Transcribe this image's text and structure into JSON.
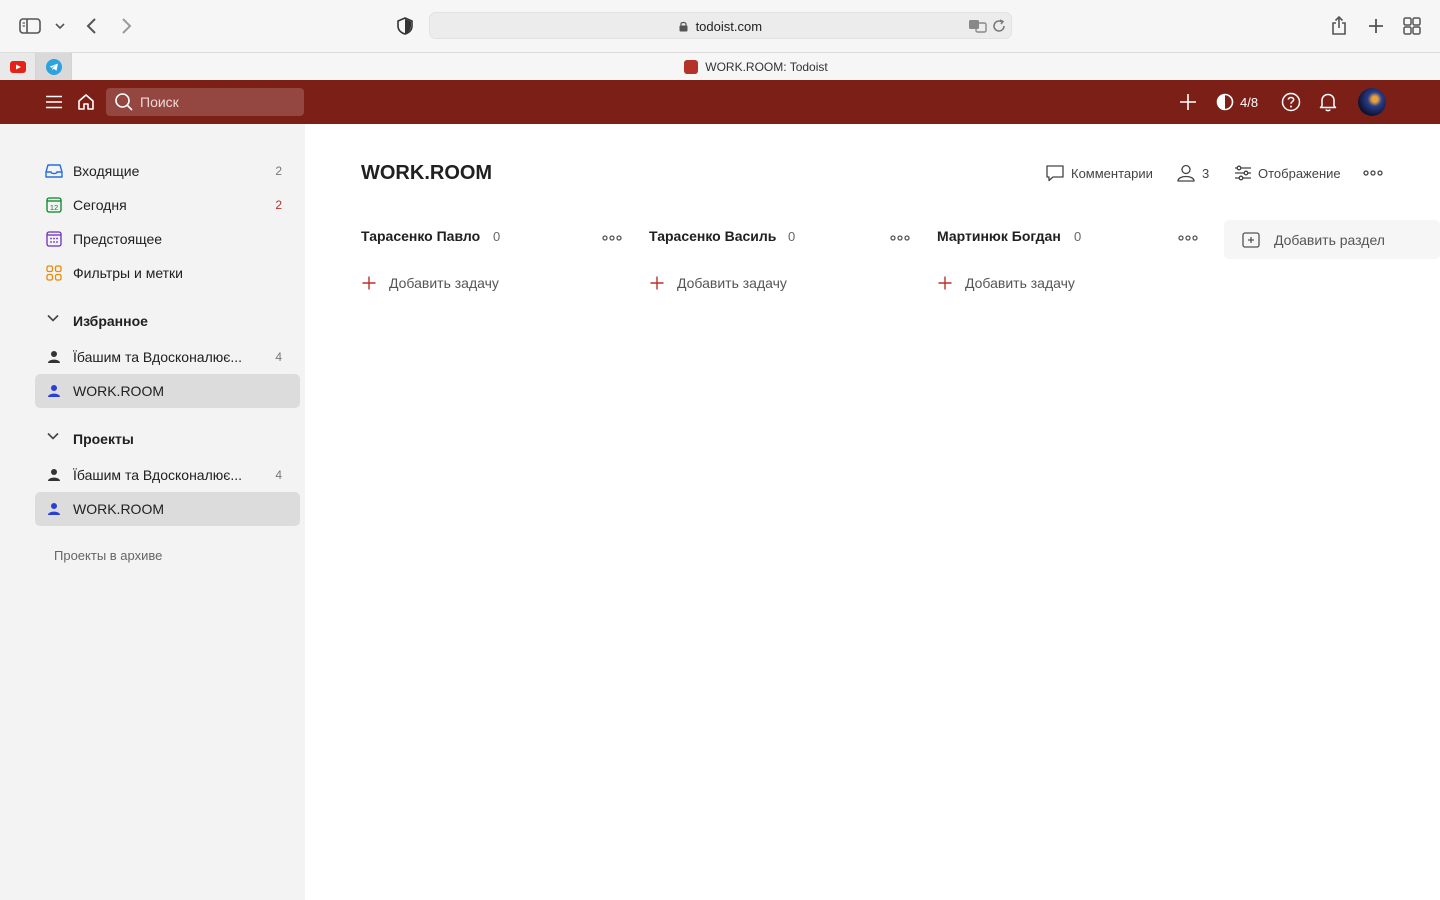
{
  "browser": {
    "url": "todoist.com",
    "active_tab_title": "WORK.ROOM: Todoist",
    "pinned_tabs": [
      {
        "name": "youtube",
        "color": "#e62117"
      },
      {
        "name": "telegram",
        "color": "#2aa3de"
      }
    ]
  },
  "topbar": {
    "search_placeholder": "Поиск",
    "karma": "4/8",
    "brand_color": "#7c1f17"
  },
  "sidebar": {
    "nav": [
      {
        "label": "Входящие",
        "count": "2",
        "icon": "inbox-icon"
      },
      {
        "label": "Сегодня",
        "count": "2",
        "icon": "today-calendar-icon"
      },
      {
        "label": "Предстоящее",
        "count": "",
        "icon": "upcoming-calendar-icon"
      },
      {
        "label": "Фильтры и метки",
        "count": "",
        "icon": "filters-grid-icon"
      }
    ],
    "favorites": {
      "title": "Избранное",
      "items": [
        {
          "label": "Їбашим та Вдосконалює...",
          "count": "4",
          "active": false
        },
        {
          "label": "WORK.ROOM",
          "count": "",
          "active": true
        }
      ]
    },
    "projects": {
      "title": "Проекты",
      "items": [
        {
          "label": "Їбашим та Вдосконалює...",
          "count": "4",
          "active": false
        },
        {
          "label": "WORK.ROOM",
          "count": "",
          "active": true
        }
      ]
    },
    "archive_label": "Проекты в архиве"
  },
  "main": {
    "title": "WORK.ROOM",
    "comments_label": "Комментарии",
    "shared_count": "3",
    "view_label": "Отображение",
    "columns": [
      {
        "title": "Тарасенко Павло",
        "count": "0",
        "add_task_label": "Добавить задачу"
      },
      {
        "title": "Тарасенко Василь",
        "count": "0",
        "add_task_label": "Добавить задачу"
      },
      {
        "title": "Мартинюк Богдан",
        "count": "0",
        "add_task_label": "Добавить задачу"
      }
    ],
    "add_section_label": "Добавить раздел"
  }
}
